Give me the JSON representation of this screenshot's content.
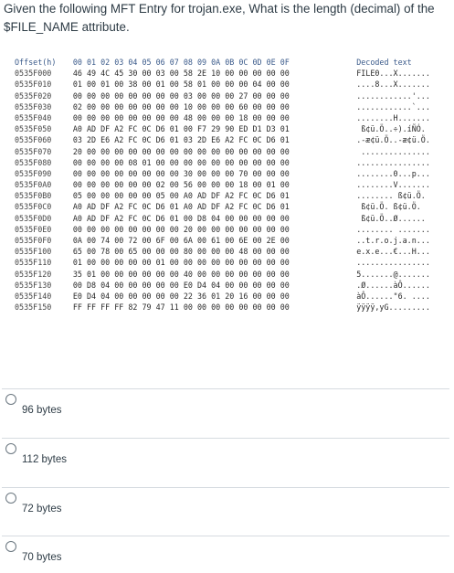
{
  "question": {
    "text": "Given the following MFT Entry for trojan.exe, What is the length (decimal) of the $FILE_NAME attribute."
  },
  "hexdump": {
    "header": {
      "offset": "Offset(h)",
      "bytes": "00 01 02 03 04 05 06 07 08 09 0A 0B 0C 0D 0E 0F",
      "decoded": "Decoded text"
    },
    "rows": [
      {
        "offset": "0535F000",
        "bytes": "46 49 4C 45 30 00 03 00 58 2E 10 00 00 00 00 00",
        "decoded": "FILE0...X......."
      },
      {
        "offset": "0535F010",
        "bytes": "01 00 01 00 38 00 01 00 58 01 00 00 00 04 00 00",
        "decoded": "....8...X......."
      },
      {
        "offset": "0535F020",
        "bytes": "00 00 00 00 00 00 00 00 03 00 00 00 27 00 00 00",
        "decoded": "............'..."
      },
      {
        "offset": "0535F030",
        "bytes": "02 00 00 00 00 00 00 00 10 00 00 00 60 00 00 00",
        "decoded": "............`..."
      },
      {
        "offset": "0535F040",
        "bytes": "00 00 00 00 00 00 00 00 48 00 00 00 18 00 00 00",
        "decoded": "........H......."
      },
      {
        "offset": "0535F050",
        "bytes": "A0 AD DF A2 FC 0C D6 01 00 F7 29 90 ED D1 D3 01",
        "decoded": " ­ß¢ü.Ö..÷).íÑÓ."
      },
      {
        "offset": "0535F060",
        "bytes": "03 2D E6 A2 FC 0C D6 01 03 2D E6 A2 FC 0C D6 01",
        "decoded": ".-æ¢ü.Ö..-æ¢ü.Ö."
      },
      {
        "offset": "0535F070",
        "bytes": "20 00 00 00 00 00 00 00 00 00 00 00 00 00 00 00",
        "decoded": " ..............."
      },
      {
        "offset": "0535F080",
        "bytes": "00 00 00 00 08 01 00 00 00 00 00 00 00 00 00 00",
        "decoded": "................"
      },
      {
        "offset": "0535F090",
        "bytes": "00 00 00 00 00 00 00 00 30 00 00 00 70 00 00 00",
        "decoded": "........0...p..."
      },
      {
        "offset": "0535F0A0",
        "bytes": "00 00 00 00 00 00 02 00 56 00 00 00 18 00 01 00",
        "decoded": "........V......."
      },
      {
        "offset": "0535F0B0",
        "bytes": "05 00 00 00 00 00 05 00 A0 AD DF A2 FC 0C D6 01",
        "decoded": "........ ­ß¢ü.Ö."
      },
      {
        "offset": "0535F0C0",
        "bytes": "A0 AD DF A2 FC 0C D6 01 A0 AD DF A2 FC 0C D6 01",
        "decoded": " ­ß¢ü.Ö. ­ß¢ü.Ö."
      },
      {
        "offset": "0535F0D0",
        "bytes": "A0 AD DF A2 FC 0C D6 01 00 D8 04 00 00 00 00 00",
        "decoded": " ­ß¢ü.Ö..Ø......"
      },
      {
        "offset": "0535F0E0",
        "bytes": "00 00 00 00 00 00 00 00 20 00 00 00 00 00 00 00",
        "decoded": "........ ......."
      },
      {
        "offset": "0535F0F0",
        "bytes": "0A 00 74 00 72 00 6F 00 6A 00 61 00 6E 00 2E 00",
        "decoded": "..t.r.o.j.a.n..."
      },
      {
        "offset": "0535F100",
        "bytes": "65 00 78 00 65 00 00 00 80 00 00 00 48 00 00 00",
        "decoded": "e.x.e...€...H..."
      },
      {
        "offset": "0535F110",
        "bytes": "01 00 00 00 00 00 01 00 00 00 00 00 00 00 00 00",
        "decoded": "................"
      },
      {
        "offset": "0535F120",
        "bytes": "35 01 00 00 00 00 00 00 40 00 00 00 00 00 00 00",
        "decoded": "5.......@......."
      },
      {
        "offset": "0535F130",
        "bytes": "00 D8 04 00 00 00 00 00 E0 D4 04 00 00 00 00 00",
        "decoded": ".Ø......àÔ......"
      },
      {
        "offset": "0535F140",
        "bytes": "E0 D4 04 00 00 00 00 00 22 36 01 20 16 00 00 00",
        "decoded": "àÔ......\"6. ...."
      },
      {
        "offset": "0535F150",
        "bytes": "FF FF FF FF 82 79 47 11 00 00 00 00 00 00 00 00",
        "decoded": "ÿÿÿÿ‚yG........."
      }
    ]
  },
  "answers": [
    {
      "label": "96 bytes"
    },
    {
      "label": "112 bytes"
    },
    {
      "label": "72 bytes"
    },
    {
      "label": "70 bytes"
    }
  ]
}
